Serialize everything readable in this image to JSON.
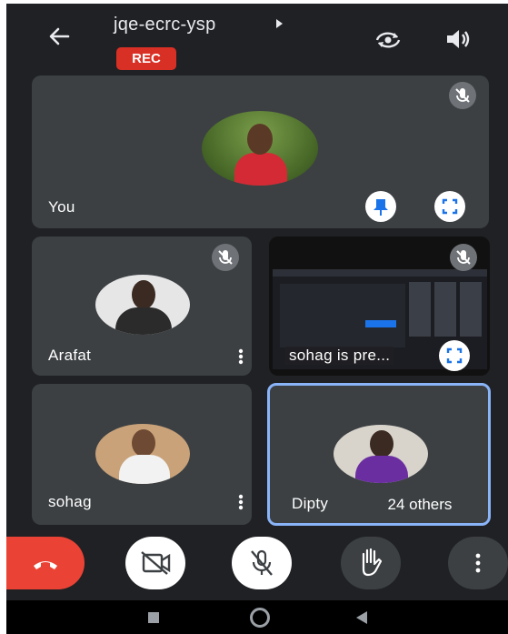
{
  "header": {
    "meeting_code": "jqe-ecrc-ysp",
    "rec_label": "REC",
    "icons": [
      "back-arrow-icon",
      "play-triangle-icon",
      "switch-camera-icon",
      "speaker-icon"
    ]
  },
  "tiles": {
    "you": {
      "name": "You",
      "muted": true,
      "icons": [
        "mic-off-icon",
        "pin-icon",
        "fullscreen-icon"
      ]
    },
    "arafat": {
      "name": "Arafat",
      "muted": true,
      "icons": [
        "mic-off-icon",
        "more-vert-icon"
      ]
    },
    "presenting": {
      "name": "sohag is pre...",
      "muted": true,
      "icons": [
        "mic-off-icon",
        "fullscreen-icon"
      ]
    },
    "sohag": {
      "name": "sohag",
      "icons": [
        "more-vert-icon"
      ]
    },
    "dipty": {
      "name": "Dipty",
      "others": "24 others",
      "active": true
    }
  },
  "controls": {
    "icons": [
      "end-call-icon",
      "camera-off-icon",
      "mic-off-icon",
      "raise-hand-icon",
      "more-vert-icon"
    ],
    "colors": {
      "end": "#ea4335",
      "active_border": "#8ab4f8"
    }
  },
  "system_nav": {
    "icons": [
      "recents-square-icon",
      "home-circle-icon",
      "back-triangle-icon"
    ]
  }
}
